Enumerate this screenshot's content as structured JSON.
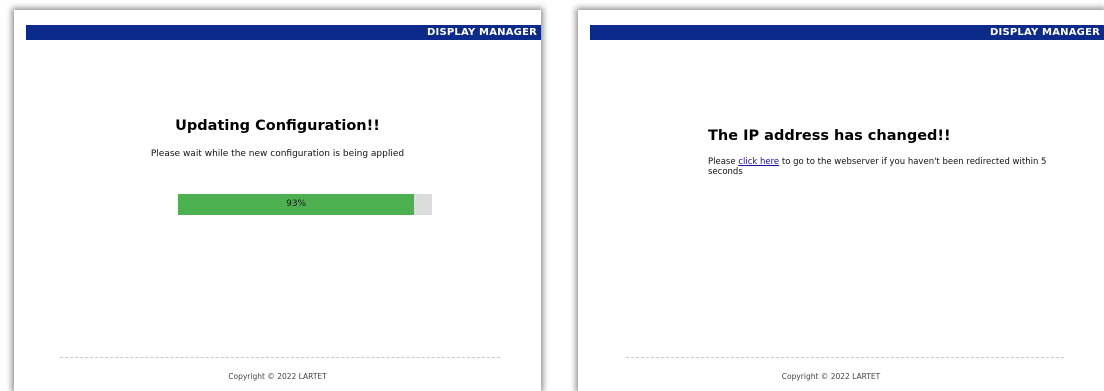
{
  "left_panel": {
    "header_title": "DISPLAY MANAGER",
    "title": "Updating Configuration!!",
    "subtitle": "Please wait while the new configuration is being applied",
    "progress": {
      "percent": 93,
      "label": "93%",
      "fill_color": "#4caf50",
      "track_color": "#dcdcdc"
    },
    "copyright": "Copyright © 2022 LARTET"
  },
  "right_panel": {
    "header_title": "DISPLAY MANAGER",
    "title": "The IP address has changed!!",
    "message_before_link": "Please ",
    "link_text": "click here",
    "message_after_link": " to go to the webserver if you haven't been redirected within 5 seconds",
    "copyright": "Copyright © 2022 LARTET"
  },
  "colors": {
    "header_bg": "#0b2a8a",
    "header_text": "#ffffff",
    "link": "#1a0dab"
  }
}
